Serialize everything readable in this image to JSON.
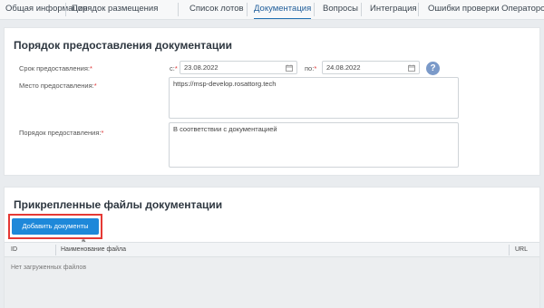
{
  "tabs": [
    {
      "label": "Общая информация",
      "active": false
    },
    {
      "label": "Порядок размещения",
      "active": false
    },
    {
      "label": "Список лотов",
      "active": false
    },
    {
      "label": "Документация",
      "active": true
    },
    {
      "label": "Вопросы",
      "active": false
    },
    {
      "label": "Интеграция",
      "active": false
    },
    {
      "label": "Ошибки проверки Оператором",
      "active": false
    }
  ],
  "documentation_order": {
    "title": "Порядок предоставления документации",
    "period_label": "Срок предоставления:",
    "from_label": "с:",
    "from_value": "23.08.2022",
    "to_label": "по:",
    "to_value": "24.08.2022",
    "place_label": "Место предоставления:",
    "place_value": "https://msp-develop.rosattorg.tech",
    "procedure_label": "Порядок предоставления:",
    "procedure_value": "В соответствии с документацией",
    "required_mark": "*",
    "help_symbol": "?"
  },
  "attached_files": {
    "title": "Прикрепленные файлы документации",
    "add_button_label": "Добавить документы",
    "columns": [
      "ID",
      "Наименование файла",
      "URL"
    ],
    "empty_message": "Нет загруженных файлов"
  },
  "colors": {
    "accent": "#1e88d9",
    "highlight": "#e53935",
    "active_tab": "#1f5d9a"
  }
}
